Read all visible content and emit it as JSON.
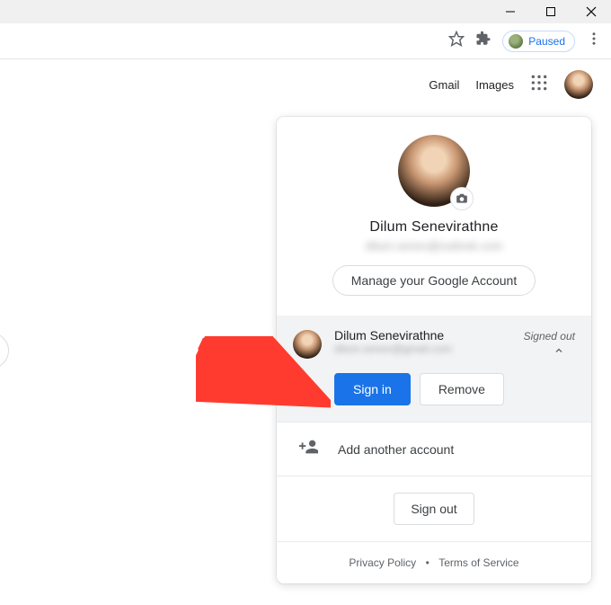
{
  "titlebar": {
    "minimize": "Minimize",
    "maximize": "Maximize",
    "close": "Close"
  },
  "addressbar": {
    "paused_label": "Paused"
  },
  "google_bar": {
    "gmail": "Gmail",
    "images": "Images"
  },
  "popup": {
    "current": {
      "name": "Dilum Senevirathne",
      "email_hidden": "dilum.senev@outlook.com",
      "manage_label": "Manage your Google Account"
    },
    "other_account": {
      "name": "Dilum Senevirathne",
      "email_hidden": "dilum.senev@gmail.com",
      "status": "Signed out",
      "signin_label": "Sign in",
      "remove_label": "Remove"
    },
    "add_account_label": "Add another account",
    "signout_label": "Sign out",
    "footer": {
      "privacy": "Privacy Policy",
      "terms": "Terms of Service",
      "separator": "•"
    }
  }
}
